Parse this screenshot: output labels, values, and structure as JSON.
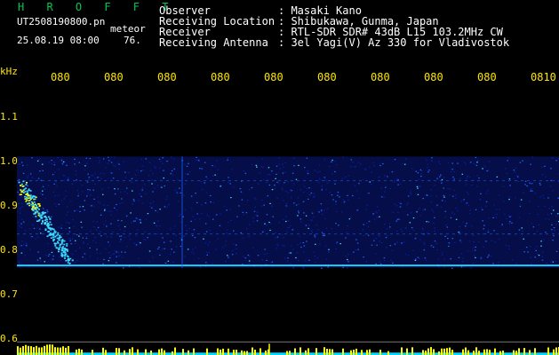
{
  "header": {
    "brand": "H R O F F T",
    "filename": "UT2508190800.pn",
    "file_tag": "meteor",
    "datetime": "25.08.19 08:00",
    "count": "76.",
    "observer_label": "Observer",
    "observer_value": ": Masaki Kano",
    "location_label": "Receiving Location",
    "location_value": ": Shibukawa, Gunma, Japan",
    "receiver_label": "Receiver",
    "receiver_value": ": RTL-SDR SDR# 43dB L15 103.2MHz CW",
    "antenna_label": "Receiving Antenna",
    "antenna_value": ": 3el Yagi(V) Az 330 for Vladivostok"
  },
  "chart_data": {
    "type": "heatmap",
    "ylabel": "kHz",
    "y_ticks": [
      "1.1",
      "1.0",
      "0.9",
      "0.8",
      "0.7",
      "0.6"
    ],
    "x_ticks": [
      "080",
      "080",
      "080",
      "080",
      "080",
      "080",
      "080",
      "080",
      "080",
      "0810"
    ],
    "ylim": [
      0.6,
      1.15
    ],
    "band": [
      0.78,
      1.01
    ],
    "lines_khz": [
      0.785,
      0.96,
      0.85
    ],
    "colors": {
      "background": "#000000",
      "low": "#0a1ea0",
      "mid": "#1e64ff",
      "high": "#3cdcff",
      "peak": "#ffff00",
      "meter_bar": "#ffff00",
      "meter_fill": "#00d8ff"
    }
  }
}
